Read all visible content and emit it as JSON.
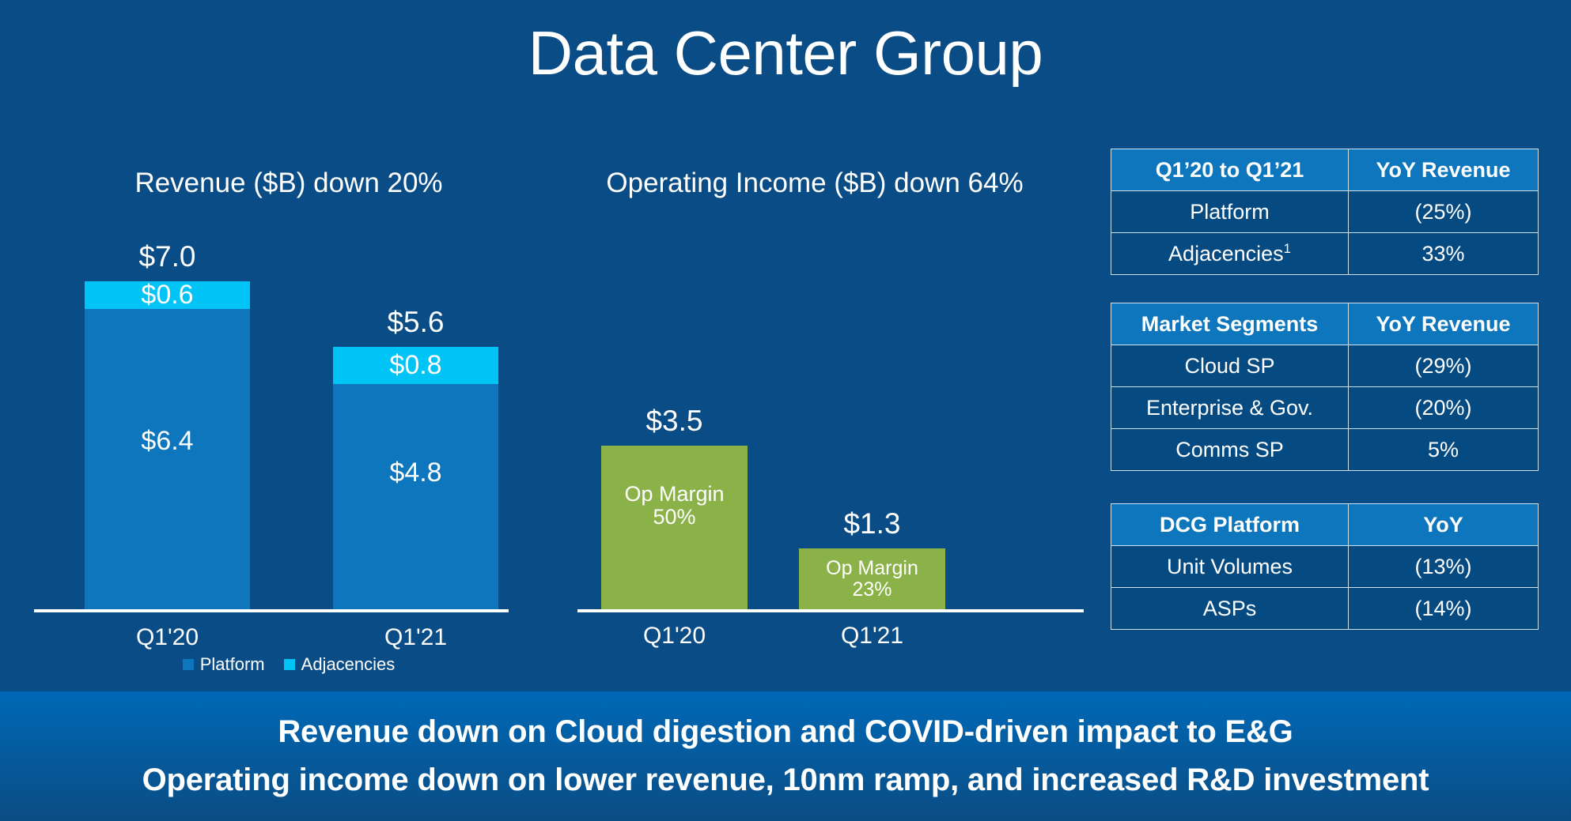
{
  "slide": {
    "title": "Data Center Group",
    "background_color": "#0a4c85"
  },
  "chart_data": [
    {
      "id": "revenue",
      "type": "bar",
      "stacked": true,
      "title": "Revenue ($B) down 20%",
      "xlabel": "",
      "ylabel": "",
      "categories": [
        "Q1'20",
        "Q1'21"
      ],
      "totals": [
        "$7.0",
        "$5.6"
      ],
      "totals_values": [
        7.0,
        5.6
      ],
      "ylim": [
        0,
        7.0
      ],
      "grid": false,
      "legend_position": "bottom",
      "series": [
        {
          "name": "Platform",
          "color": "#0e76bc",
          "values": [
            6.4,
            4.8
          ],
          "labels": [
            "$6.4",
            "$4.8"
          ]
        },
        {
          "name": "Adjacencies",
          "color": "#00c4f5",
          "values": [
            0.6,
            0.8
          ],
          "labels": [
            "$0.6",
            "$0.8"
          ]
        }
      ]
    },
    {
      "id": "operating_income",
      "type": "bar",
      "stacked": false,
      "title": "Operating Income ($B) down 64%",
      "xlabel": "",
      "ylabel": "",
      "categories": [
        "Q1'20",
        "Q1'21"
      ],
      "totals": [
        "$3.5",
        "$1.3"
      ],
      "values": [
        3.5,
        1.3
      ],
      "ylim": [
        0,
        7.0
      ],
      "grid": false,
      "color": "#8bb249",
      "annotations": [
        {
          "line1": "Op Margin",
          "line2": "50%"
        },
        {
          "line1": "Op Margin",
          "line2": "23%"
        }
      ]
    }
  ],
  "tables": [
    {
      "id": "yoy-revenue",
      "headers": [
        "Q1’20 to Q1’21",
        "YoY Revenue"
      ],
      "rows": [
        {
          "label": "Platform",
          "label_sup": "",
          "value": "(25%)"
        },
        {
          "label": "Adjacencies",
          "label_sup": "1",
          "value": "33%"
        }
      ]
    },
    {
      "id": "market-segments",
      "headers": [
        "Market Segments",
        "YoY Revenue"
      ],
      "rows": [
        {
          "label": "Cloud SP",
          "label_sup": "",
          "value": "(29%)"
        },
        {
          "label": "Enterprise & Gov.",
          "label_sup": "",
          "value": "(20%)"
        },
        {
          "label": "Comms SP",
          "label_sup": "",
          "value": "5%"
        }
      ]
    },
    {
      "id": "dcg-platform",
      "headers": [
        "DCG Platform",
        "YoY"
      ],
      "rows": [
        {
          "label": "Unit Volumes",
          "label_sup": "",
          "value": "(13%)"
        },
        {
          "label": "ASPs",
          "label_sup": "",
          "value": "(14%)"
        }
      ]
    }
  ],
  "banner": {
    "line1": "Revenue down on Cloud digestion and COVID-driven impact to E&G",
    "line2": "Operating income down on lower revenue, 10nm ramp, and increased R&D investment"
  },
  "colors": {
    "background": "#0a4c85",
    "platform_blue": "#0e76bc",
    "adjacency_cyan": "#00c4f5",
    "green": "#8bb249",
    "table_cell": "#064a82",
    "table_header": "#0e76bc",
    "banner_top": "#0069b7",
    "banner_bottom": "#0a4c83"
  }
}
